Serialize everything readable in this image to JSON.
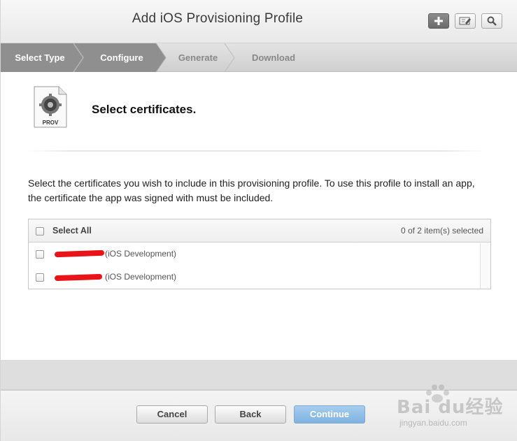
{
  "header": {
    "title": "Add iOS Provisioning Profile",
    "tools": [
      {
        "name": "add",
        "icon": "plus-icon"
      },
      {
        "name": "edit",
        "icon": "pencil-icon"
      },
      {
        "name": "search",
        "icon": "search-icon"
      }
    ]
  },
  "steps": [
    {
      "label": "Select Type",
      "state": "done"
    },
    {
      "label": "Configure",
      "state": "done"
    },
    {
      "label": "Generate",
      "state": "todo"
    },
    {
      "label": "Download",
      "state": "todo"
    }
  ],
  "content": {
    "icon_caption": "PROV",
    "section_title": "Select certificates.",
    "description": "Select the certificates you wish to include in this provisioning profile. To use this profile to install an app, the certificate the app was signed with must be included."
  },
  "table": {
    "select_all_label": "Select All",
    "selected_count": "0 of 2 item(s) selected",
    "rows": [
      {
        "label": "(iOS Development)",
        "checked": false
      },
      {
        "label": "(iOS Development)",
        "checked": false
      }
    ]
  },
  "footer": {
    "cancel_label": "Cancel",
    "back_label": "Back",
    "continue_label": "Continue"
  },
  "watermark": {
    "text": "Bai du经验",
    "sub": "jingyan.baidu.com"
  },
  "colors": {
    "accent": "#8dbde8",
    "step_done": "#8f8f8f",
    "redaction": "#e8141a"
  }
}
